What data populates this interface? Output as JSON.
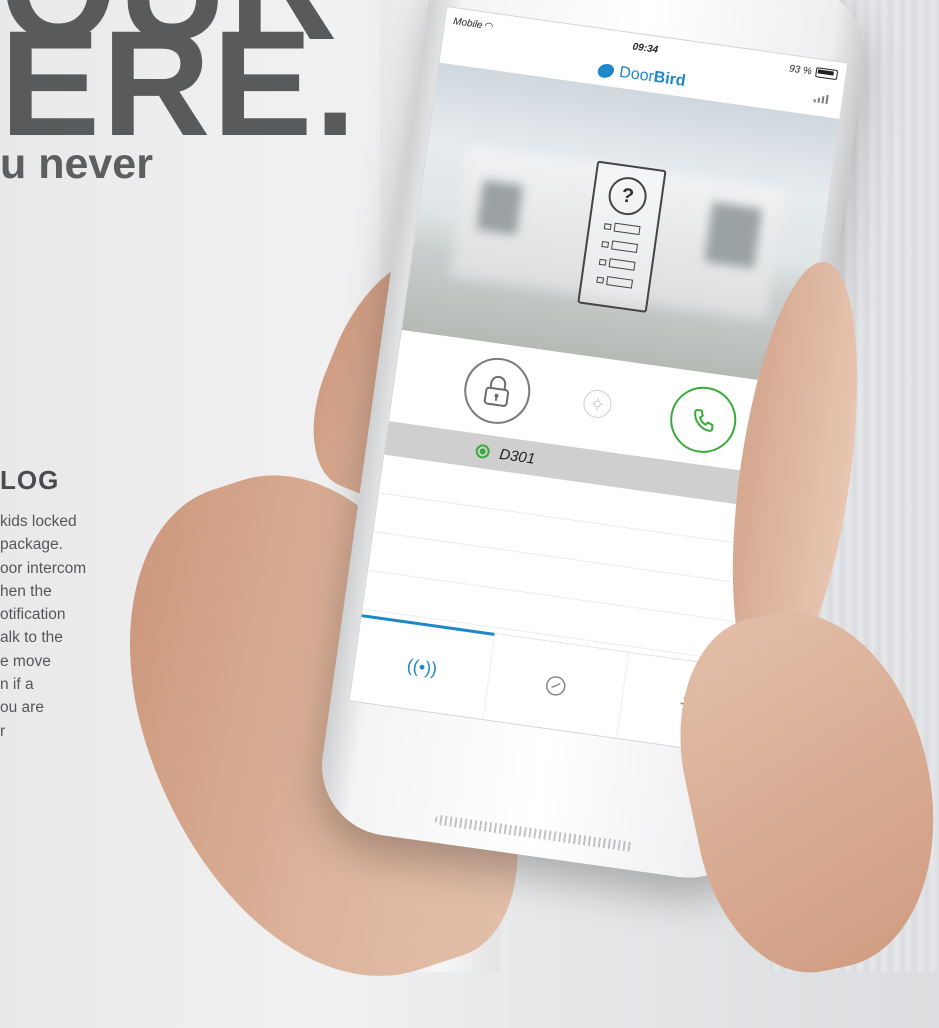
{
  "hero": {
    "line1": "OUR",
    "line2": "ERE.",
    "subline": "u never"
  },
  "section": {
    "title": "LOG",
    "body": "kids locked\n package.\noor intercom\nhen the\notification\nalk to the\ne move\nn if a\nou are\nr"
  },
  "phone": {
    "status_bar": {
      "carrier": "Mobile",
      "time": "09:34",
      "battery": "93 %"
    },
    "app": {
      "logo_regular": "Door",
      "logo_bold": "Bird",
      "device_name": "D301",
      "tabs": [
        {
          "name": "live",
          "icon": "broadcast-icon",
          "active": true
        },
        {
          "name": "history",
          "icon": "clock-icon",
          "active": false
        },
        {
          "name": "settings",
          "icon": "gear-icon",
          "active": false
        }
      ],
      "colors": {
        "accent": "#1e88c8",
        "call_green": "#3aaa3a",
        "device_row_bg": "#cfcfcf"
      }
    }
  }
}
